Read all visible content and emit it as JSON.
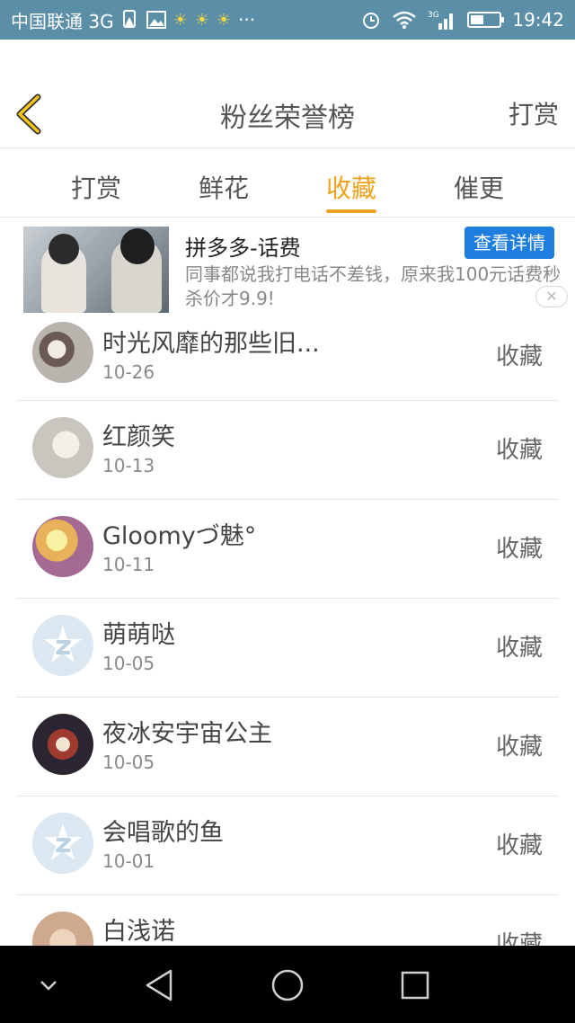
{
  "status_bar": {
    "carrier": "中国联通 3G",
    "network_label": "3G",
    "time": "19:42",
    "icons": [
      "sim-alert-icon",
      "image-icon",
      "bulb-icon",
      "bulb-icon",
      "bulb-icon",
      "more-icon",
      "alarm-icon",
      "wifi-icon",
      "signal-icon",
      "battery-icon"
    ]
  },
  "header": {
    "title": "粉丝荣誉榜",
    "right_action": "打赏"
  },
  "tabs": [
    {
      "label": "打赏",
      "active": false
    },
    {
      "label": "鲜花",
      "active": false
    },
    {
      "label": "收藏",
      "active": true
    },
    {
      "label": "催更",
      "active": false
    }
  ],
  "ad": {
    "title": "拼多多-话费",
    "description": "同事都说我打电话不差钱，原来我100元话费秒杀价才9.9!",
    "button_label": "查看详情"
  },
  "fans": [
    {
      "name": "时光风靡的那些旧...",
      "date": "10-26",
      "action": "收藏",
      "avatar": "photo"
    },
    {
      "name": "红颜笑",
      "date": "10-13",
      "action": "收藏",
      "avatar": "photo"
    },
    {
      "name": "Gloomyづ魅°",
      "date": "10-11",
      "action": "收藏",
      "avatar": "photo"
    },
    {
      "name": "萌萌哒",
      "date": "10-05",
      "action": "收藏",
      "avatar": "default"
    },
    {
      "name": "夜冰安宇宙公主",
      "date": "10-05",
      "action": "收藏",
      "avatar": "photo"
    },
    {
      "name": "会唱歌的鱼",
      "date": "10-01",
      "action": "收藏",
      "avatar": "default"
    },
    {
      "name": "白浅诺",
      "date": "",
      "action": "收藏",
      "avatar": "photo"
    }
  ],
  "colors": {
    "accent": "#f0a21d",
    "status_bar": "#5b8fa8",
    "ad_button": "#1e7ee0"
  }
}
